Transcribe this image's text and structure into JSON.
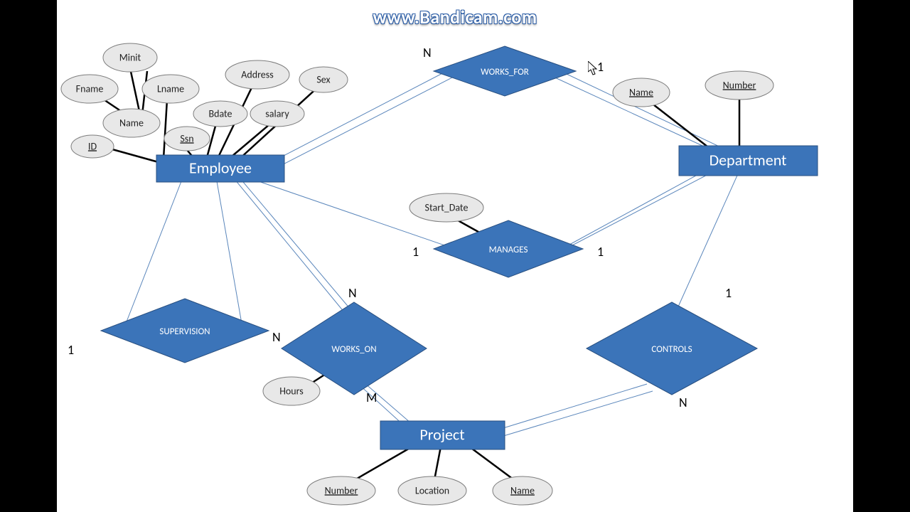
{
  "watermark": "www.Bandicam.com",
  "entities": {
    "employee": "Employee",
    "department": "Department",
    "project": "Project"
  },
  "relationships": {
    "works_for": "WORKS_FOR",
    "manages": "MANAGES",
    "supervision": "SUPERVISION",
    "works_on": "WORKS_ON",
    "controls": "CONTROLS"
  },
  "attributes": {
    "minit": "Minit",
    "fname": "Fname",
    "lname": "Lname",
    "name": "Name",
    "id": "ID",
    "ssn": "Ssn",
    "bdate": "Bdate",
    "address": "Address",
    "salary": "salary",
    "sex": "Sex",
    "dept_name": "Name",
    "dept_number": "Number",
    "start_date": "Start_Date",
    "hours": "Hours",
    "proj_number": "Number",
    "location": "Location",
    "proj_name": "Name"
  },
  "cardinalities": {
    "wf_emp": "N",
    "wf_dept": "1",
    "mg_emp": "1",
    "mg_dept": "1",
    "sv_sup": "1",
    "sv_sub": "N",
    "wo_emp": "N",
    "wo_proj": "M",
    "ct_dept": "1",
    "ct_proj": "N"
  }
}
